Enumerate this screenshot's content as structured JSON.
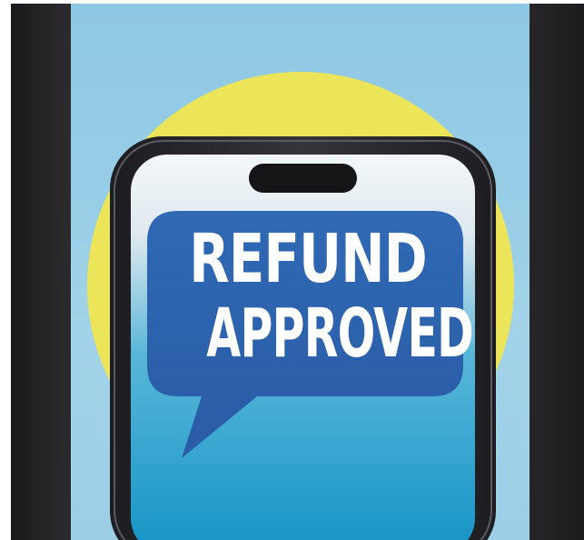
{
  "poster": {
    "headline_line1": "REFUND",
    "headline_line2": "APPROVED"
  },
  "colors": {
    "background_sky": "#97cde6",
    "sun_circle": "#ece55a",
    "phone_frame": "#2a2a2e",
    "speech_bubble": "#2f63ad",
    "screen_top": "#eef3f6",
    "screen_bottom": "#1797c9",
    "headline_text": "#ffffff",
    "side_bars": "#222224"
  },
  "icons": {
    "phone": "smartphone-icon",
    "bubble": "speech-bubble-icon"
  }
}
